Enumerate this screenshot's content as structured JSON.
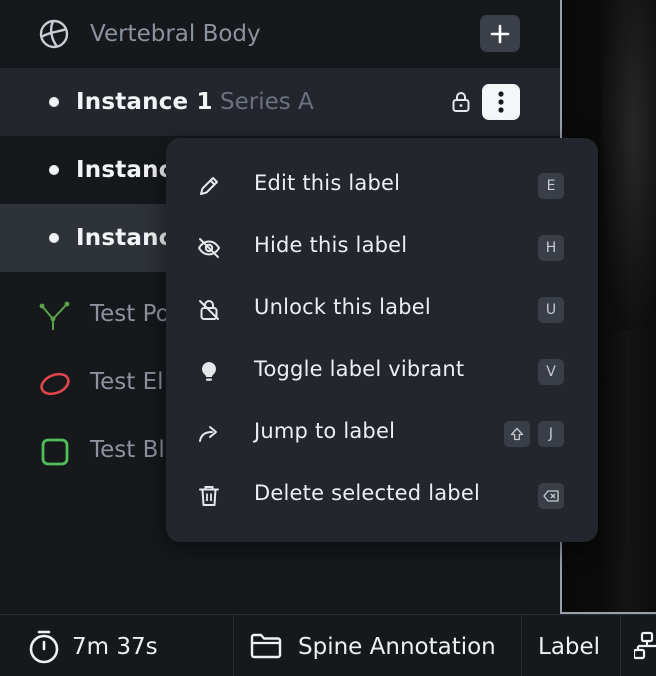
{
  "layer": {
    "title": "Vertebral Body",
    "icon": "globe-icon",
    "add_button_icon": "plus-icon"
  },
  "instances": [
    {
      "label": "Instance 1",
      "series": "Series A",
      "locked": true
    },
    {
      "label": "Instance"
    },
    {
      "label": "Instance"
    }
  ],
  "tools": [
    {
      "label": "Test Po",
      "icon": "polyline-icon",
      "color": "#5aa34a"
    },
    {
      "label": "Test El",
      "icon": "ellipse-icon",
      "color": "#e0464a"
    },
    {
      "label": "Test Bl",
      "icon": "box-icon",
      "color": "#4fbf5a"
    }
  ],
  "context_menu": {
    "items": [
      {
        "label": "Edit this label",
        "icon": "pencil-icon",
        "shortcut": "E"
      },
      {
        "label": "Hide this label",
        "icon": "eye-off-icon",
        "shortcut": "H"
      },
      {
        "label": "Unlock this label",
        "icon": "unlock-icon",
        "shortcut": "U"
      },
      {
        "label": "Toggle label vibrant",
        "icon": "lightbulb-icon",
        "shortcut": "V"
      },
      {
        "label": "Jump to label",
        "icon": "share-arrow-icon",
        "shortcut": "J",
        "modifier": "shift"
      },
      {
        "label": "Delete selected label",
        "icon": "trash-icon",
        "shortcut_icon": "backspace-icon"
      }
    ]
  },
  "statusbar": {
    "timer": "7m 37s",
    "project": "Spine Annotation",
    "mode": "Label"
  },
  "colors": {
    "background": "#16181c",
    "menu_bg": "#23262c",
    "selected_row": "#2e3239"
  }
}
